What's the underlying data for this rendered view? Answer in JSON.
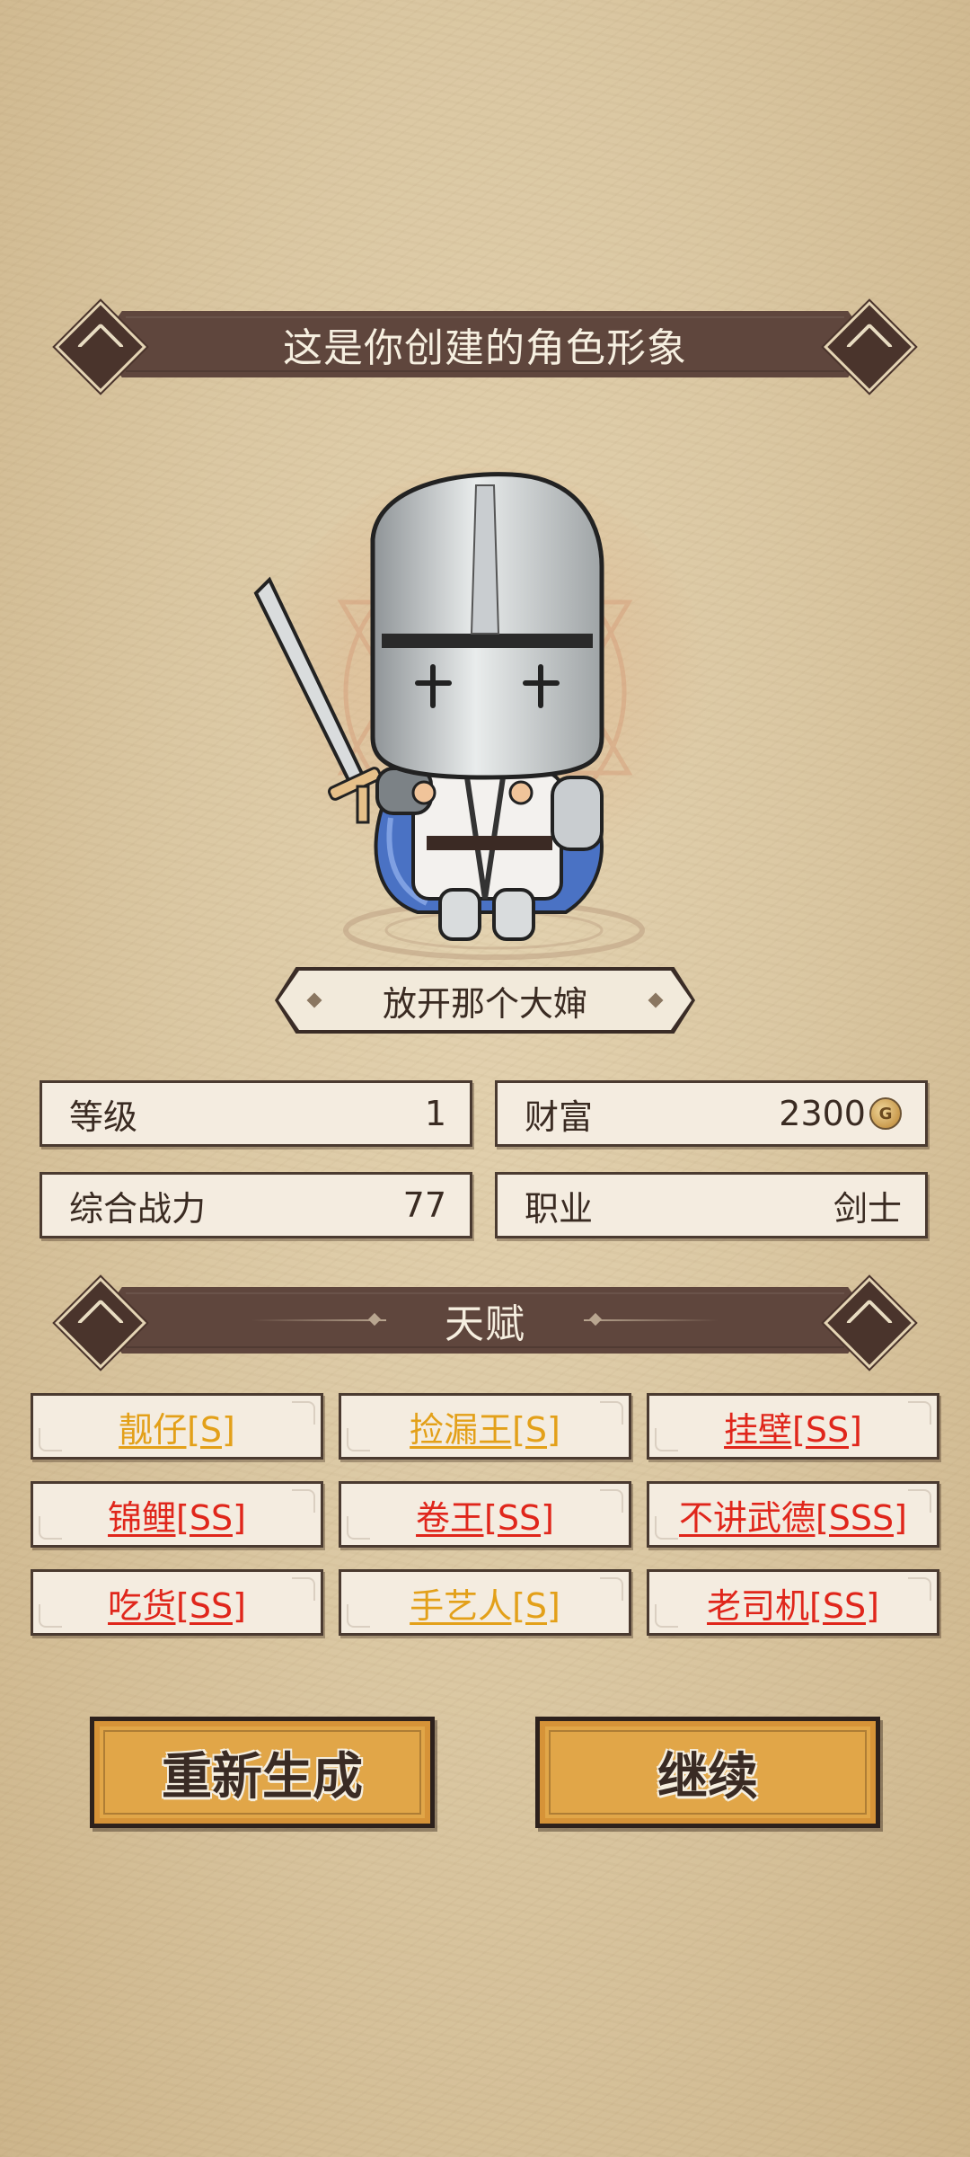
{
  "header": {
    "title": "这是你创建的角色形象"
  },
  "character": {
    "name": "放开那个大婶"
  },
  "stats": {
    "level_label": "等级",
    "level_value": "1",
    "wealth_label": "财富",
    "wealth_value": "2300",
    "power_label": "综合战力",
    "power_value": "77",
    "class_label": "职业",
    "class_value": "剑士"
  },
  "talents": {
    "title": "天赋",
    "items": [
      {
        "label": "靓仔[S]",
        "color": "#e3a019"
      },
      {
        "label": "捡漏王[S]",
        "color": "#e3a019"
      },
      {
        "label": "挂壁[SS]",
        "color": "#e0261b"
      },
      {
        "label": "锦鲤[SS]",
        "color": "#e0261b"
      },
      {
        "label": "卷王[SS]",
        "color": "#e0261b"
      },
      {
        "label": "不讲武德[SSS]",
        "color": "#e0261b"
      },
      {
        "label": "吃货[SS]",
        "color": "#e0261b"
      },
      {
        "label": "手艺人[S]",
        "color": "#e3a019"
      },
      {
        "label": "老司机[SS]",
        "color": "#e0261b"
      }
    ]
  },
  "actions": {
    "regenerate_label": "重新生成",
    "continue_label": "继续"
  },
  "icons": {
    "coin": "gold-coin-icon",
    "hero": "knight-character"
  }
}
